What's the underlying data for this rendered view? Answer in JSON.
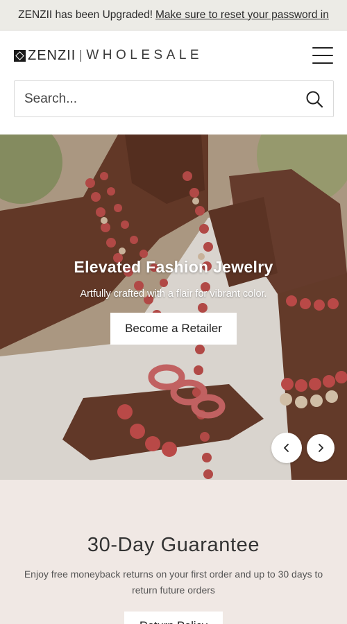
{
  "announcement": {
    "text": "ZENZII has been Upgraded!",
    "link": "Make sure to reset your password in"
  },
  "header": {
    "logo_main": "ZENZII",
    "logo_sub": "WHOLESALE"
  },
  "search": {
    "placeholder": "Search..."
  },
  "hero": {
    "title": "Elevated Fashion Jewelry",
    "subtitle": "Artfully crafted with a flair for vibrant color.",
    "cta": "Become a Retailer"
  },
  "guarantee": {
    "title": "30-Day Guarantee",
    "text": "Enjoy free moneyback returns on your first order and up to 30 days to return future orders",
    "cta": "Return Policy"
  },
  "icons": {
    "menu": "hamburger-menu-icon",
    "search": "search-icon",
    "prev": "chevron-left-icon",
    "next": "chevron-right-icon"
  }
}
